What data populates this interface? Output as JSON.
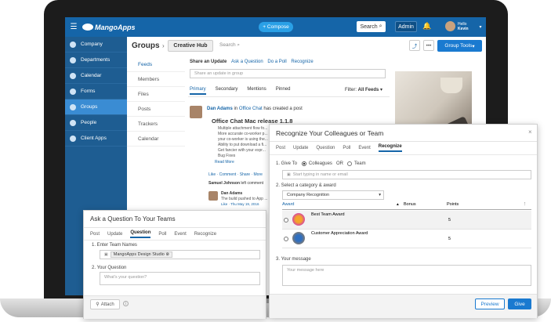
{
  "topbar": {
    "brand": "MangoApps",
    "compose": "+ Compose",
    "search": "Search",
    "admin": "Admin",
    "hello": "Hello",
    "user": "Kevin"
  },
  "sidebar": {
    "items": [
      {
        "label": "Company"
      },
      {
        "label": "Departments"
      },
      {
        "label": "Calendar"
      },
      {
        "label": "Forms"
      },
      {
        "label": "Groups"
      },
      {
        "label": "People"
      },
      {
        "label": "Client Apps"
      }
    ]
  },
  "header": {
    "section": "Groups",
    "group_name": "Creative Hub",
    "search_placeholder": "Search",
    "group_tools": "Group Tools",
    "more": "•••"
  },
  "subnav": [
    "Feeds",
    "Members",
    "Files",
    "Posts",
    "Trackers",
    "Calendar"
  ],
  "share": {
    "label": "Share an Update",
    "ask": "Ask a Question",
    "poll": "Do a Poll",
    "recognize": "Recognize",
    "placeholder": "Share an update in group"
  },
  "feed_tabs": [
    "Primary",
    "Secondary",
    "Mentions",
    "Pinned"
  ],
  "filter": {
    "label": "Filter:",
    "value": "All Feeds"
  },
  "post": {
    "author": "Dan Adams",
    "in": "in",
    "place": "Office Chat",
    "action": "has created a post",
    "title": "Office Chat Mac release 1.1.8",
    "bullets": [
      "Multiple attachment flow fo...",
      "More accurate co-worker p...",
      "your co-worker is using the...",
      "Ability to put download a fi...",
      "Get fancier with your expr...",
      "Bug Fixes"
    ],
    "read_more": "Read More",
    "actions": "Like · Comment · Share · More",
    "commenter": "Samuel Johnson",
    "commenter_action": "left comment",
    "reply_author": "Dan Adams",
    "reply_text": "The build pushed to App ...",
    "reply_meta": "Like · Thu May 19, 2016"
  },
  "ask_panel": {
    "title": "Ask a Question To Your Teams",
    "tabs": [
      "Post",
      "Update",
      "Question",
      "Poll",
      "Event",
      "Recognize"
    ],
    "step1": "1. Enter Team Names",
    "team_chip": "MangoApps Design Studio",
    "step2": "2. Your Question",
    "question_placeholder": "What's your question?",
    "attach": "Attach"
  },
  "recognize_panel": {
    "title": "Recognize Your Colleagues or Team",
    "tabs": [
      "Post",
      "Update",
      "Question",
      "Poll",
      "Event",
      "Recognize"
    ],
    "step1": "1. Give To",
    "opt1": "Colleagues",
    "or": "OR",
    "opt2": "Team",
    "give_placeholder": "Start typing in name or email",
    "step2": "2. Select a category & award",
    "category": "Company Recognition",
    "columns": [
      "Award",
      "Bonus",
      "Points"
    ],
    "awards": [
      {
        "name": "Best Team Award",
        "points": "5"
      },
      {
        "name": "Customer Appreciation Award",
        "points": "5"
      }
    ],
    "step3": "3. Your message",
    "message_placeholder": "Your message here",
    "preview": "Preview",
    "give": "Give"
  },
  "colors": {
    "brand_blue": "#1565a8",
    "sidebar": "#1e5d92",
    "active": "#3a8cd3"
  }
}
